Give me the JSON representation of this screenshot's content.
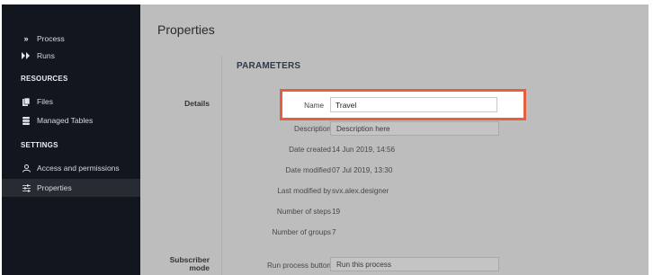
{
  "sidebar": {
    "items_top": [
      {
        "label": "Process",
        "icon": "double-chevron-icon"
      },
      {
        "label": "Runs",
        "icon": "play-double-icon"
      }
    ],
    "resources_heading": "RESOURCES",
    "resources": [
      {
        "label": "Files",
        "icon": "file-icon"
      },
      {
        "label": "Managed Tables",
        "icon": "database-icon"
      }
    ],
    "settings_heading": "SETTINGS",
    "settings": [
      {
        "label": "Access and permissions",
        "icon": "user-icon"
      },
      {
        "label": "Properties",
        "icon": "sliders-icon",
        "active": true
      }
    ]
  },
  "main": {
    "title": "Properties",
    "parameters_heading": "PARAMETERS",
    "details_label": "Details",
    "subscriber_label_1": "Subscriber",
    "subscriber_label_2": "mode",
    "name": {
      "label": "Name",
      "value": "Travel"
    },
    "description": {
      "label": "Description",
      "value": "Description here"
    },
    "date_created": {
      "label": "Date created",
      "value": "14 Jun 2019, 14:56"
    },
    "date_modified": {
      "label": "Date modified",
      "value": "07 Jul 2019, 13:30"
    },
    "last_modified_by": {
      "label": "Last modified by",
      "value": "svx.alex.designer"
    },
    "number_of_steps": {
      "label": "Number of steps",
      "value": "19"
    },
    "number_of_groups": {
      "label": "Number of groups",
      "value": "7"
    },
    "run_process_button": {
      "label": "Run process button",
      "value": "Run this process"
    }
  },
  "colors": {
    "sidebar_bg": "#12171f",
    "main_bg": "#bdbdbd",
    "highlight_border": "#e35f3f"
  }
}
